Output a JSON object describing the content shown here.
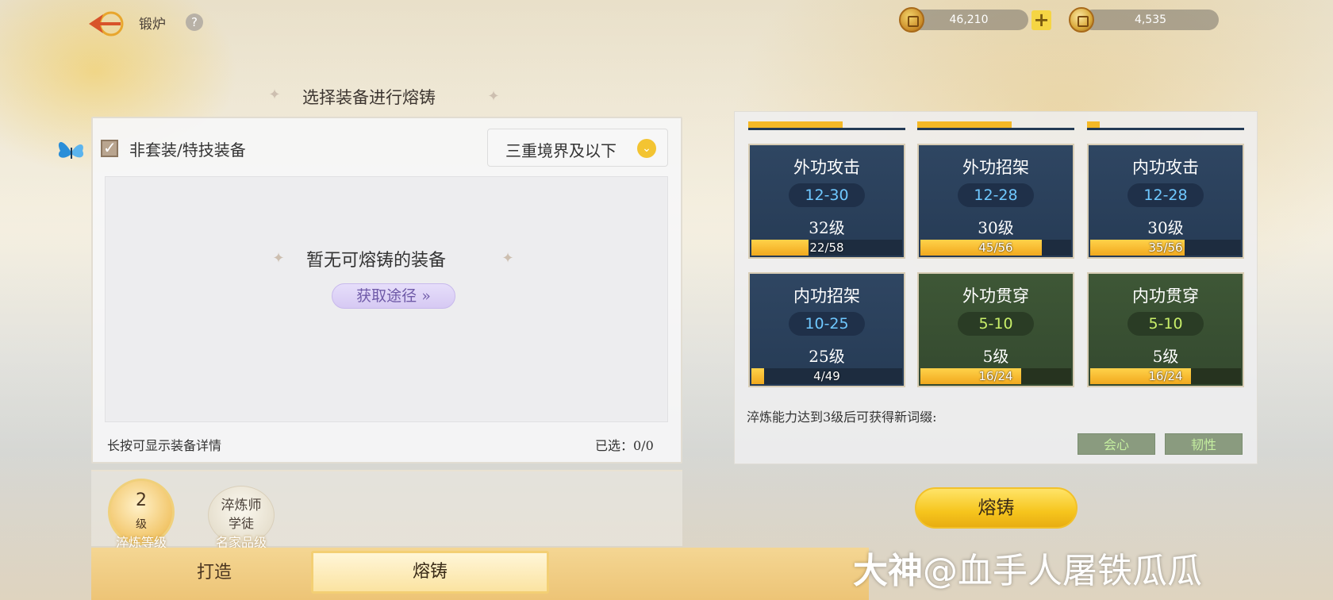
{
  "header": {
    "title": "锻炉",
    "help_symbol": "?",
    "currency1": "46,210",
    "currency2": "4,535",
    "plus": "+"
  },
  "left": {
    "section_title": "选择装备进行熔铸",
    "filter_label": "非套装/特技装备",
    "dropdown_value": "三重境界及以下",
    "empty_text": "暂无可熔铸的装备",
    "source_button": "获取途径 »",
    "hint": "长按可显示装备详情",
    "selected": "已选：0/0"
  },
  "levels": {
    "refine_level": "2",
    "refine_unit": "级",
    "refine_label": "淬炼等级",
    "rank_title": "淬炼师",
    "rank_sub": "学徒",
    "rank_label": "名家品级"
  },
  "tabs": {
    "forge": "打造",
    "smelt": "熔铸"
  },
  "cards": [
    {
      "name": "外功攻击",
      "range": "12-30",
      "level": "32级",
      "progress": "22/58",
      "fill": 0.379,
      "color": "blue"
    },
    {
      "name": "外功招架",
      "range": "12-28",
      "level": "30级",
      "progress": "45/56",
      "fill": 0.804,
      "color": "blue"
    },
    {
      "name": "内功攻击",
      "range": "12-28",
      "level": "30级",
      "progress": "35/56",
      "fill": 0.625,
      "color": "blue"
    },
    {
      "name": "内功招架",
      "range": "10-25",
      "level": "25级",
      "progress": "4/49",
      "fill": 0.082,
      "color": "blue"
    },
    {
      "name": "外功贯穿",
      "range": "5-10",
      "level": "5级",
      "progress": "16/24",
      "fill": 0.667,
      "color": "green"
    },
    {
      "name": "内功贯穿",
      "range": "5-10",
      "level": "5级",
      "progress": "16/24",
      "fill": 0.667,
      "color": "green"
    }
  ],
  "affix": {
    "hint": "淬炼能力达到3级后可获得新词缀:",
    "tag1": "会心",
    "tag2": "韧性"
  },
  "action": {
    "smelt_button": "熔铸"
  },
  "watermark": {
    "brand": "大神",
    "handle": "@血手人屠铁瓜瓜"
  },
  "colors": {
    "accent_gold": "#f6c51d",
    "card_blue": "#2f4662",
    "card_green": "#3e5736",
    "range_blue": "#6fc8ff",
    "range_green": "#c9ef6a"
  }
}
